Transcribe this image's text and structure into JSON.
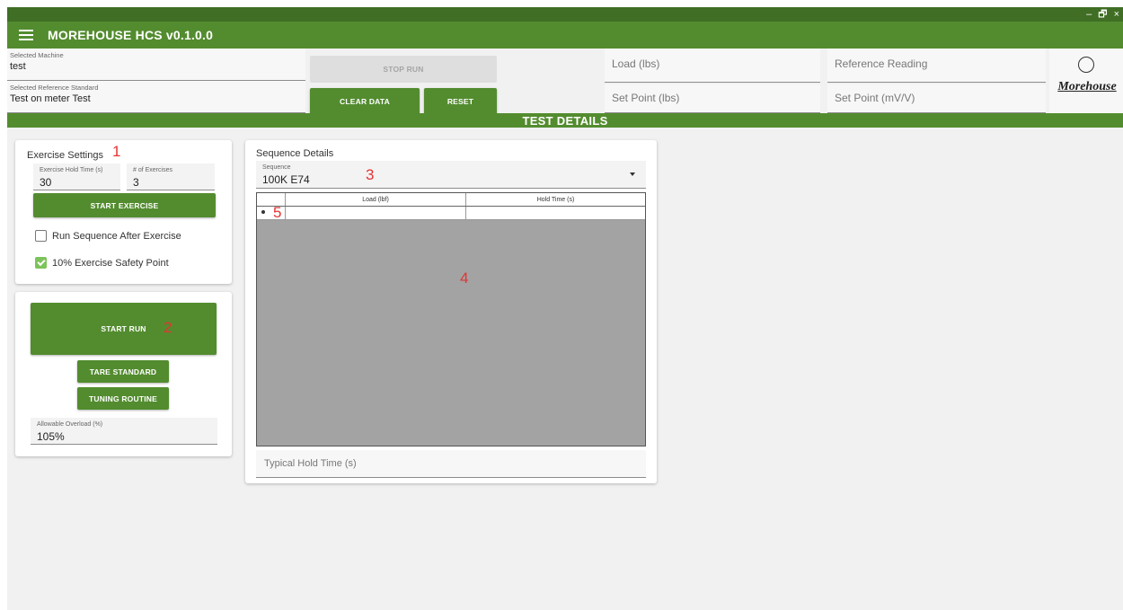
{
  "window": {
    "minimize": "–",
    "restore": "🗗",
    "close": "×"
  },
  "app": {
    "title": "MOREHOUSE HCS v0.1.0.0"
  },
  "header": {
    "selected_machine": {
      "label": "Selected Machine",
      "value": "test"
    },
    "selected_reference": {
      "label": "Selected Reference Standard",
      "value": "Test on meter Test"
    },
    "stop_run": "STOP RUN",
    "clear_data": "CLEAR DATA",
    "reset": "RESET",
    "load_placeholder": "Load (lbs)",
    "set_point_lbs_placeholder": "Set Point (lbs)",
    "reference_reading_placeholder": "Reference Reading",
    "set_point_mvv_placeholder": "Set Point (mV/V)",
    "logo_text": "Morehouse"
  },
  "section": {
    "title": "TEST DETAILS"
  },
  "exercise": {
    "title": "Exercise Settings",
    "hold_time": {
      "label": "Exercise Hold Time (s)",
      "value": "30"
    },
    "num_exercises": {
      "label": "# of Exercises",
      "value": "3"
    },
    "start_exercise": "START EXERCISE",
    "run_sequence_after": {
      "label": "Run Sequence After Exercise",
      "checked": false
    },
    "safety_point": {
      "label": "10% Exercise Safety Point",
      "checked": true
    }
  },
  "run": {
    "start_run": "START RUN",
    "tare_standard": "TARE STANDARD",
    "tuning_routine": "TUNING ROUTINE",
    "allowable_overload": {
      "label": "Allowable Overload (%)",
      "value": "105%"
    }
  },
  "sequence": {
    "title": "Sequence Details",
    "selector": {
      "label": "Sequence",
      "value": "100K E74"
    },
    "grid": {
      "columns": [
        "Load (lbf)",
        "Hold Time (s)"
      ]
    },
    "typical_hold_placeholder": "Typical Hold Time (s)"
  },
  "annotations": [
    "1",
    "2",
    "3",
    "4",
    "5"
  ],
  "colors": {
    "primary_green": "#538c2f",
    "dark_green": "#3f6e24",
    "annotation_red": "#e53333",
    "grid_gray": "#a3a3a3"
  }
}
